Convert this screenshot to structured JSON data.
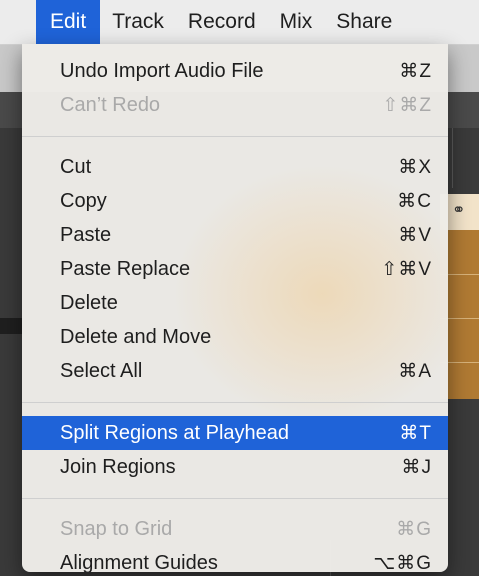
{
  "menubar": {
    "items": [
      "Edit",
      "Track",
      "Record",
      "Mix",
      "Share"
    ]
  },
  "edit_menu": {
    "groups": [
      [
        {
          "label": "Undo Import Audio File",
          "shortcut": "⌘Z",
          "enabled": true
        },
        {
          "label": "Can’t Redo",
          "shortcut": "⇧⌘Z",
          "enabled": false
        }
      ],
      [
        {
          "label": "Cut",
          "shortcut": "⌘X",
          "enabled": true
        },
        {
          "label": "Copy",
          "shortcut": "⌘C",
          "enabled": true
        },
        {
          "label": "Paste",
          "shortcut": "⌘V",
          "enabled": true
        },
        {
          "label": "Paste Replace",
          "shortcut": "⇧⌘V",
          "enabled": true
        },
        {
          "label": "Delete",
          "shortcut": "",
          "enabled": true
        },
        {
          "label": "Delete and Move",
          "shortcut": "",
          "enabled": true
        },
        {
          "label": "Select All",
          "shortcut": "⌘A",
          "enabled": true
        }
      ],
      [
        {
          "label": "Split Regions at Playhead",
          "shortcut": "⌘T",
          "enabled": true,
          "highlighted": true
        },
        {
          "label": "Join Regions",
          "shortcut": "⌘J",
          "enabled": true
        }
      ],
      [
        {
          "label": "Snap to Grid",
          "shortcut": "⌘G",
          "enabled": false
        },
        {
          "label": "Alignment Guides",
          "shortcut": "⌥⌘G",
          "enabled": true
        }
      ]
    ]
  },
  "colors": {
    "highlight": "#1f63d8",
    "region": "#b07a33"
  }
}
